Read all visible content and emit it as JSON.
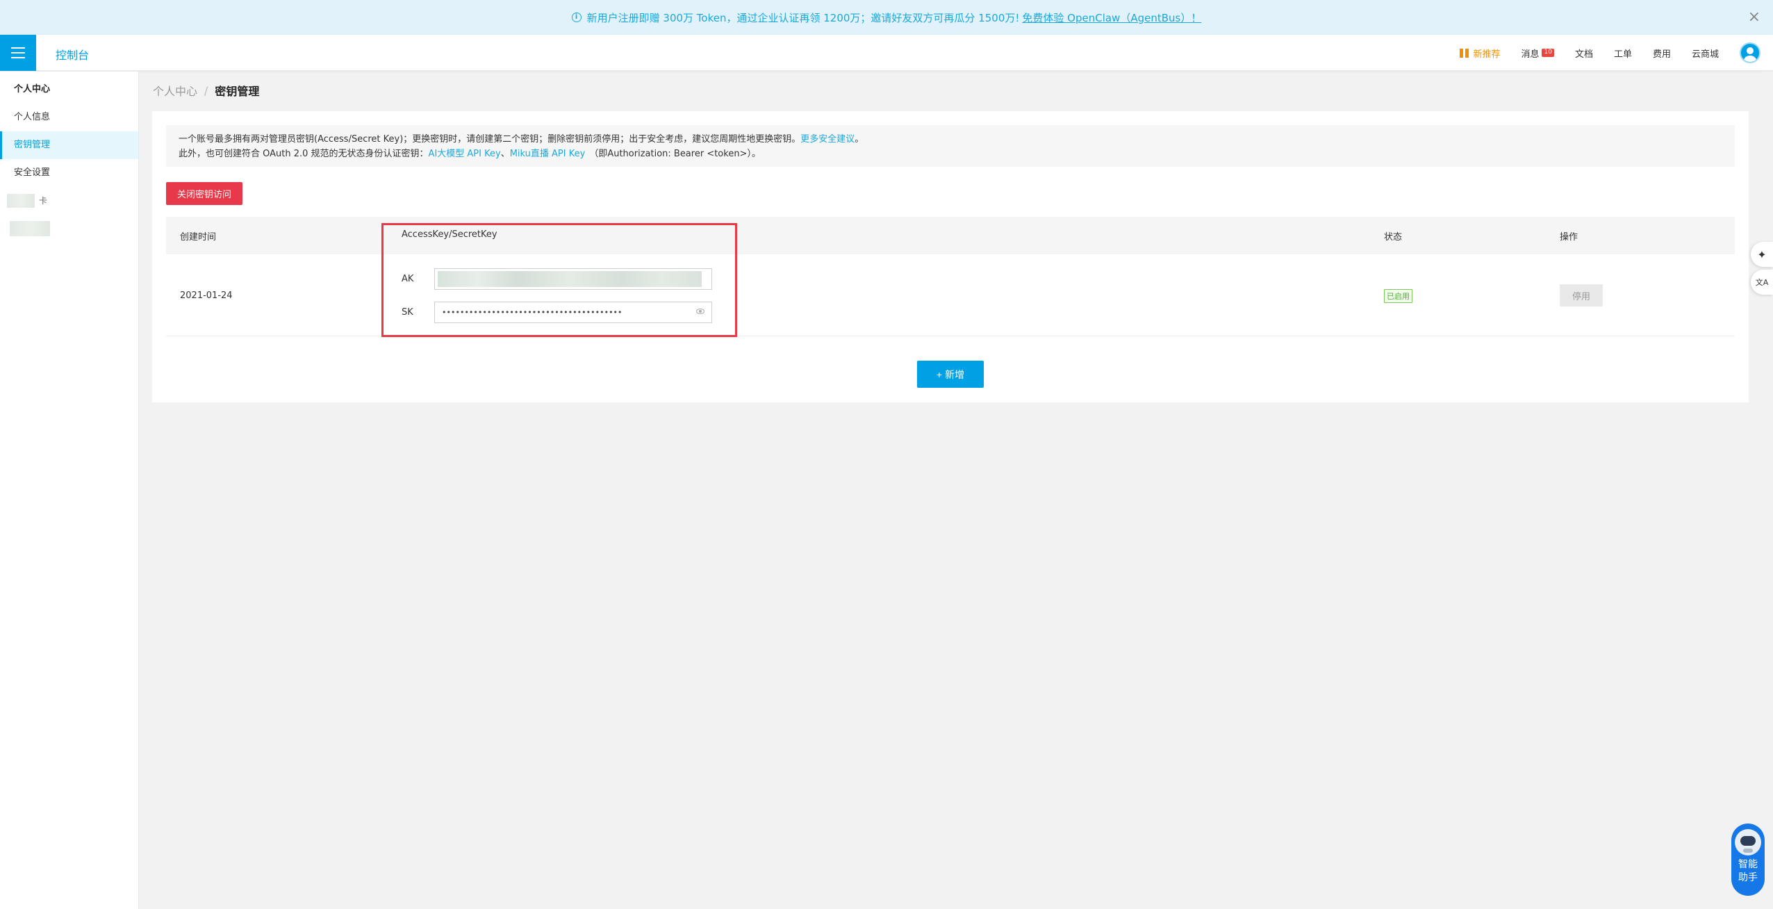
{
  "banner": {
    "text": "新用户注册即赠 300万 Token，通过企业认证再领 1200万；邀请好友双方可再瓜分 1500万!",
    "link": "免费体验 OpenClaw（AgentBus）！",
    "close": "×"
  },
  "topnav": {
    "console_title": "控制台",
    "hot": "新推荐",
    "messages": "消息",
    "message_badge": "10",
    "docs": "文档",
    "tickets": "工单",
    "billing": "费用",
    "store": "云商城"
  },
  "sidebar": {
    "section_title": "个人中心",
    "items": [
      {
        "label": "个人信息"
      },
      {
        "label": "密钥管理"
      },
      {
        "label": "安全设置"
      },
      {
        "label": "卡"
      }
    ]
  },
  "breadcrumb": {
    "parent": "个人中心",
    "separator": "/",
    "current": "密钥管理"
  },
  "notice": {
    "line1": "一个账号最多拥有两对管理员密钥(Access/Secret Key)；更换密钥时，请创建第二个密钥；删除密钥前须停用；出于安全考虑，建议您周期性地更换密钥。",
    "line1_link": "更多安全建议",
    "line1_end": "。",
    "line2": "此外，也可创建符合 OAuth 2.0 规范的无状态身份认证密钥：",
    "line2_link1": "AI大模型 API Key",
    "line2_sep": "、",
    "line2_link2": "Miku直播 API Key",
    "line2_end": "（即Authorization: Bearer <token>）。"
  },
  "actions": {
    "close_key_access": "关闭密钥访问",
    "add": "新增",
    "add_icon": "+"
  },
  "table": {
    "headers": {
      "created": "创建时间",
      "key": "AccessKey/SecretKey",
      "status": "状态",
      "ops": "操作"
    },
    "rows": [
      {
        "created": "2021-01-24",
        "ak_label": "AK",
        "sk_label": "SK",
        "sk_value": "••••••••••••••••••••••••••••••••••••••••",
        "status": "已启用",
        "op": "停用"
      }
    ]
  },
  "float": {
    "ai_icon": "✦",
    "translate_icon": "文A",
    "assistant_line1": "智能",
    "assistant_line2": "助手"
  },
  "colors": {
    "brand": "#00a1e4",
    "danger": "#e8394a",
    "success": "#52b033",
    "highlight": "#e83a45"
  }
}
